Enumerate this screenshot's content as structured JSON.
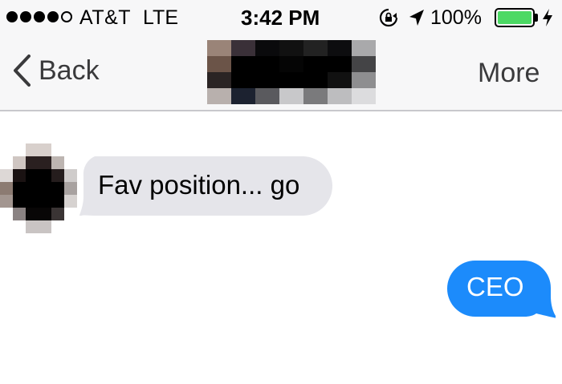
{
  "status_bar": {
    "carrier": "AT&T",
    "network": "LTE",
    "time": "3:42 PM",
    "battery_percent": "100%",
    "battery_level": 1.0,
    "battery_color": "#4cd964",
    "icons": [
      "rotation-lock-icon",
      "location-arrow-icon",
      "battery-icon",
      "charging-bolt-icon"
    ]
  },
  "nav_bar": {
    "back_label": "Back",
    "more_label": "More",
    "contact_photo": "pixelated-contact-photo"
  },
  "messages": [
    {
      "direction": "incoming",
      "text": "Fav position... go",
      "bubble_color": "#e5e5ea"
    },
    {
      "direction": "outgoing",
      "text": "CEO",
      "bubble_color": "#1c8bfb"
    }
  ]
}
